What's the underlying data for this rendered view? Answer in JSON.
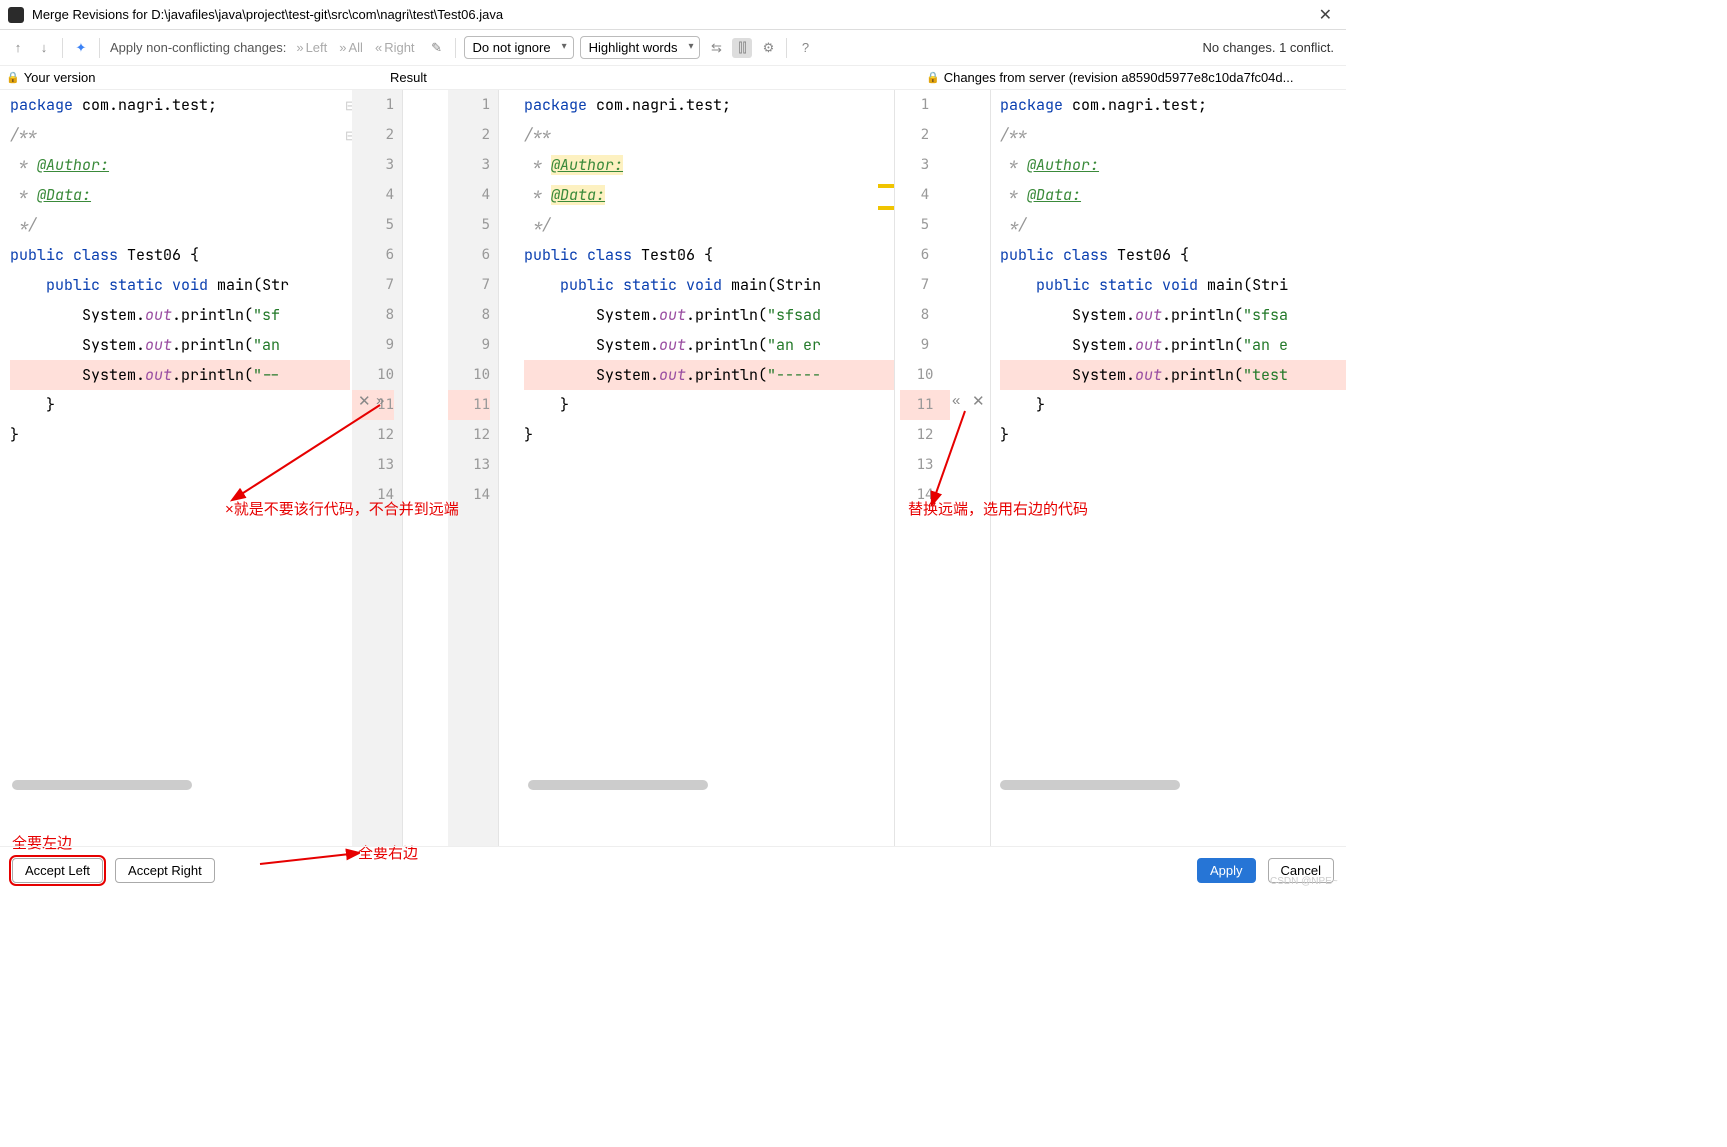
{
  "title": "Merge Revisions for D:\\javafiles\\java\\project\\test-git\\src\\com\\nagri\\test\\Test06.java",
  "toolbar": {
    "apply_label": "Apply non-conflicting changes:",
    "nav_left": "Left",
    "nav_all": "All",
    "nav_right": "Right",
    "ignore_dd": "Do not ignore",
    "highlight_dd": "Highlight words"
  },
  "status": "No changes. 1 conflict.",
  "headers": {
    "left": "Your version",
    "mid": "Result",
    "right": "Changes from server (revision a8590d5977e8c10da7fc04d..."
  },
  "lines": {
    "numbers": [
      "1",
      "2",
      "3",
      "4",
      "5",
      "6",
      "7",
      "8",
      "9",
      "10",
      "11",
      "12",
      "13",
      "14"
    ]
  },
  "code": {
    "left": [
      {
        "t": "package",
        "c": "kw"
      },
      {
        "p": " com.nagri.test;"
      },
      {
        "br": 1
      },
      {
        "br": 1
      },
      {
        "t": "/**",
        "c": "cmt"
      },
      {
        "br": 1
      },
      {
        "t": " * ",
        "c": "cmt"
      },
      {
        "t": "@Author:",
        "c": "tag"
      },
      {
        "br": 1
      },
      {
        "t": " * ",
        "c": "cmt"
      },
      {
        "t": "@Data:",
        "c": "tag"
      },
      {
        "br": 1
      },
      {
        "t": " */",
        "c": "cmt"
      },
      {
        "br": 1
      },
      {
        "t": "public class",
        "c": "kw"
      },
      {
        "p": " "
      },
      {
        "t": "Test06",
        "c": "cls"
      },
      {
        "p": " {"
      },
      {
        "br": 1
      },
      {
        "p": "    "
      },
      {
        "t": "public static void",
        "c": "kw"
      },
      {
        "p": " "
      },
      {
        "t": "main",
        "c": "cls"
      },
      {
        "p": "(Str"
      },
      {
        "br": 1
      },
      {
        "p": "        System."
      },
      {
        "t": "out",
        "c": "field"
      },
      {
        "p": ".println("
      },
      {
        "t": "\"sf",
        "c": "str"
      },
      {
        "br": 1
      },
      {
        "p": "        System."
      },
      {
        "t": "out",
        "c": "field"
      },
      {
        "p": ".println("
      },
      {
        "t": "\"an",
        "c": "str"
      },
      {
        "br": 1
      },
      {
        "p": "        System.",
        "conf": true
      },
      {
        "t": "out",
        "c": "field",
        "conf": true
      },
      {
        "p": ".println(",
        "conf": true
      },
      {
        "t": "\"--",
        "c": "str",
        "conf": true
      },
      {
        "br": 1
      },
      {
        "p": "    }"
      },
      {
        "br": 1
      },
      {
        "p": "}"
      },
      {
        "br": 1
      }
    ],
    "mid": [
      {
        "t": "package",
        "c": "kw"
      },
      {
        "p": " com.nagri.test;"
      },
      {
        "br": 1
      },
      {
        "br": 1
      },
      {
        "t": "/**",
        "c": "cmt"
      },
      {
        "br": 1
      },
      {
        "t": " * ",
        "c": "cmt"
      },
      {
        "t": "@Author:",
        "c": "tag hl-tag"
      },
      {
        "br": 1
      },
      {
        "t": " * ",
        "c": "cmt"
      },
      {
        "t": "@Data:",
        "c": "tag hl-tag"
      },
      {
        "br": 1
      },
      {
        "t": " */",
        "c": "cmt"
      },
      {
        "br": 1
      },
      {
        "t": "public class",
        "c": "kw"
      },
      {
        "p": " "
      },
      {
        "t": "Test06",
        "c": "cls"
      },
      {
        "p": " {"
      },
      {
        "br": 1
      },
      {
        "p": "    "
      },
      {
        "t": "public static void",
        "c": "kw"
      },
      {
        "p": " "
      },
      {
        "t": "main",
        "c": "cls"
      },
      {
        "p": "(Strin"
      },
      {
        "br": 1
      },
      {
        "p": "        System."
      },
      {
        "t": "out",
        "c": "field"
      },
      {
        "p": ".println("
      },
      {
        "t": "\"sfsad",
        "c": "str"
      },
      {
        "br": 1
      },
      {
        "p": "        System."
      },
      {
        "t": "out",
        "c": "field"
      },
      {
        "p": ".println("
      },
      {
        "t": "\"an er",
        "c": "str"
      },
      {
        "br": 1
      },
      {
        "p": "        System.",
        "conf": true
      },
      {
        "t": "out",
        "c": "field",
        "conf": true
      },
      {
        "p": ".println(",
        "conf": true
      },
      {
        "t": "\"-----",
        "c": "str",
        "conf": true
      },
      {
        "br": 1
      },
      {
        "p": "    }"
      },
      {
        "br": 1
      },
      {
        "p": "}"
      },
      {
        "br": 1
      }
    ],
    "right": [
      {
        "t": "package",
        "c": "kw"
      },
      {
        "p": " com.nagri.test;"
      },
      {
        "br": 1
      },
      {
        "br": 1
      },
      {
        "t": "/**",
        "c": "cmt"
      },
      {
        "br": 1
      },
      {
        "t": " * ",
        "c": "cmt"
      },
      {
        "t": "@Author:",
        "c": "tag"
      },
      {
        "br": 1
      },
      {
        "t": " * ",
        "c": "cmt"
      },
      {
        "t": "@Data:",
        "c": "tag"
      },
      {
        "br": 1
      },
      {
        "t": " */",
        "c": "cmt"
      },
      {
        "br": 1
      },
      {
        "t": "public class",
        "c": "kw"
      },
      {
        "p": " "
      },
      {
        "t": "Test06",
        "c": "cls"
      },
      {
        "p": " {"
      },
      {
        "br": 1
      },
      {
        "p": "    "
      },
      {
        "t": "public static void",
        "c": "kw"
      },
      {
        "p": " "
      },
      {
        "t": "main",
        "c": "cls"
      },
      {
        "p": "(Stri"
      },
      {
        "br": 1
      },
      {
        "p": "        System."
      },
      {
        "t": "out",
        "c": "field"
      },
      {
        "p": ".println("
      },
      {
        "t": "\"sfsa",
        "c": "str"
      },
      {
        "br": 1
      },
      {
        "p": "        System."
      },
      {
        "t": "out",
        "c": "field"
      },
      {
        "p": ".println("
      },
      {
        "t": "\"an e",
        "c": "str"
      },
      {
        "br": 1
      },
      {
        "p": "        System.",
        "conf": true
      },
      {
        "t": "out",
        "c": "field",
        "conf": true
      },
      {
        "p": ".println(",
        "conf": true
      },
      {
        "t": "\"test",
        "c": "str",
        "conf": true
      },
      {
        "br": 1
      },
      {
        "p": "    }"
      },
      {
        "br": 1
      },
      {
        "p": "}"
      },
      {
        "br": 1
      }
    ]
  },
  "inline_actions": {
    "reject": "✕",
    "accept_right": "»",
    "accept_left": "«"
  },
  "annotations": {
    "a1": "×就是不要该行代码，不合并到远端",
    "a2": "替换远端，选用右边的代码",
    "a3": "全要左边",
    "a4": "全要右边"
  },
  "footer": {
    "accept_left": "Accept Left",
    "accept_right": "Accept Right",
    "apply": "Apply",
    "cancel": "Cancel"
  },
  "watermark": "CSDN @NPE~"
}
